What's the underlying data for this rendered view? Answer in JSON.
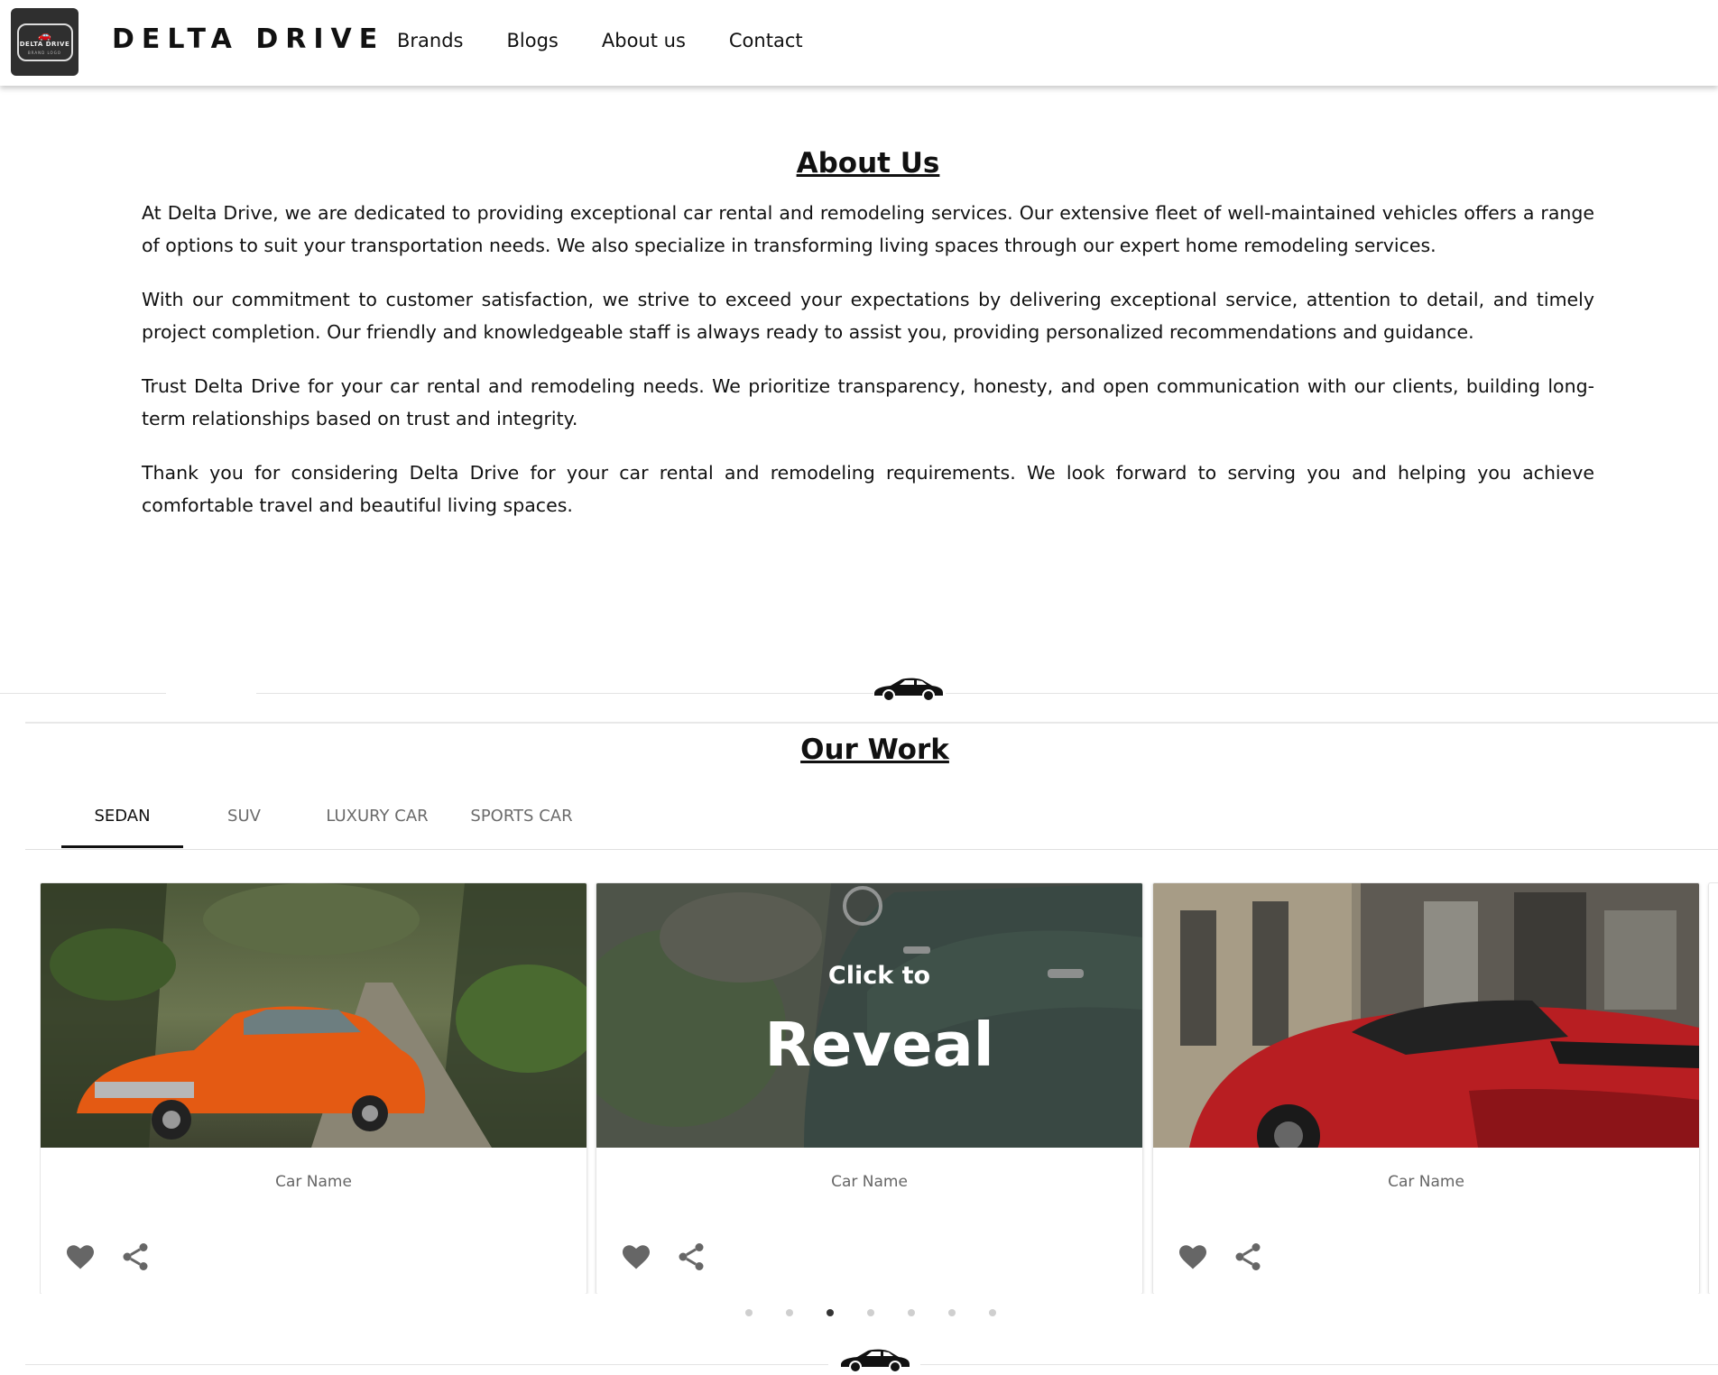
{
  "header": {
    "logo": {
      "line1": "DELTA DRIVE",
      "line2": "BRAND LOGO"
    },
    "brand": "DELTA DRIVE",
    "nav": [
      "Brands",
      "Blogs",
      "About us",
      "Contact"
    ]
  },
  "about": {
    "title": "About Us",
    "paragraphs": [
      "At Delta Drive, we are dedicated to providing exceptional car rental and remodeling services. Our extensive fleet of well-maintained vehicles offers a range of options to suit your transportation needs. We also specialize in transforming living spaces through our expert home remodeling services.",
      "With our commitment to customer satisfaction, we strive to exceed your expectations by delivering exceptional service, attention to detail, and timely project completion. Our friendly and knowledgeable staff is always ready to assist you, providing personalized recommendations and guidance.",
      "Trust Delta Drive for your car rental and remodeling needs. We prioritize transparency, honesty, and open communication with our clients, building long-term relationships based on trust and integrity.",
      "Thank you for considering Delta Drive for your car rental and remodeling requirements. We look forward to serving you and helping you achieve comfortable travel and beautiful living spaces."
    ]
  },
  "work": {
    "title": "Our Work",
    "tabs": [
      "SEDAN",
      "SUV",
      "LUXURY CAR",
      "SPORTS CAR"
    ],
    "active_tab": "SEDAN",
    "cards": [
      {
        "name": "Car Name",
        "image": "orange-classic-car-forest"
      },
      {
        "name": "Car Name",
        "image": "green-vintage-car",
        "overlay_small": "Click to",
        "overlay_big": "Reveal"
      },
      {
        "name": "Car Name",
        "image": "red-sports-car-street"
      }
    ],
    "carousel": {
      "pages": 7,
      "active_page": 3
    }
  },
  "icons": {
    "heart": "heart-icon",
    "share": "share-icon",
    "divider": "car-silhouette-icon"
  }
}
